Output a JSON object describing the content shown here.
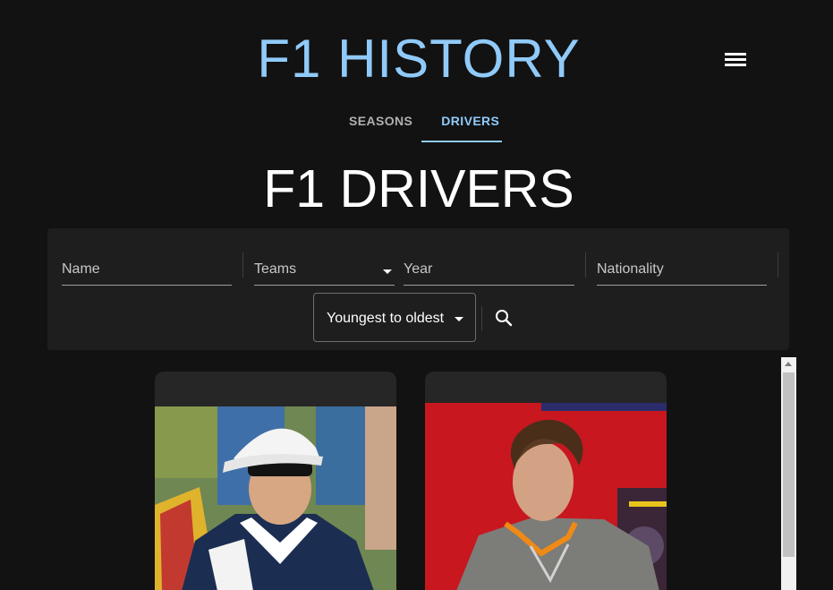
{
  "header": {
    "title": "F1 HISTORY",
    "menu_icon": "hamburger-menu-icon"
  },
  "tabs": [
    {
      "label": "SEASONS",
      "active": false
    },
    {
      "label": "DRIVERS",
      "active": true
    }
  ],
  "page_title": "F1 DRIVERS",
  "filters": {
    "name_label": "Name",
    "teams_label": "Teams",
    "year_label": "Year",
    "nationality_label": "Nationality",
    "sort_value": "Youngest to oldest",
    "search_icon": "search-icon"
  },
  "colors": {
    "accent": "#90caf9",
    "background": "#121212",
    "panel": "#1e1e1e"
  },
  "drivers": [
    {
      "photo_description": "driver in white cap and sunglasses, navy team shirt"
    },
    {
      "photo_description": "driver with curly hair in grey team jacket on red background"
    }
  ]
}
